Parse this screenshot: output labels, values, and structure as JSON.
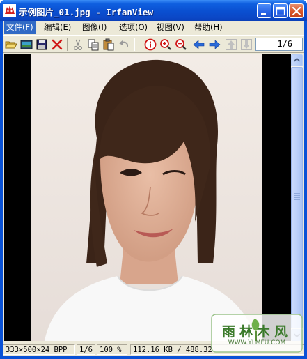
{
  "window": {
    "title": "示例图片_01.jpg - IrfanView",
    "title_icon": "irfanview-red-cat-icon",
    "controls": [
      "minimize-icon",
      "maximize-icon",
      "close-icon"
    ]
  },
  "menu": {
    "items": [
      {
        "label": "文件(F)",
        "active": true
      },
      {
        "label": "编辑(E)",
        "active": false
      },
      {
        "label": "图像(I)",
        "active": false
      },
      {
        "label": "选项(O)",
        "active": false
      },
      {
        "label": "视图(V)",
        "active": false
      },
      {
        "label": "帮助(H)",
        "active": false
      }
    ]
  },
  "toolbar": {
    "icons": [
      "open-folder-icon",
      "slideshow-icon",
      "save-icon",
      "delete-icon",
      "cut-icon",
      "copy-icon",
      "paste-icon",
      "undo-icon",
      "info-icon",
      "zoom-in-icon",
      "zoom-out-icon",
      "previous-arrow-icon",
      "next-arrow-icon",
      "up-arrow-icon",
      "down-arrow-icon"
    ],
    "page_indicator": "1/6"
  },
  "statusbar": {
    "image_info": "333×500×24 BPP",
    "page": "1/6",
    "zoom": "100 %",
    "filesize": "112.16 KB / 488.32"
  },
  "watermark": {
    "text": "雨林木风",
    "url": "WWW.YLMFU.COM"
  },
  "colors": {
    "titlebar": "#0a4fd0",
    "menu_highlight": "#316ac5",
    "chrome": "#ece9d8",
    "view_background": "#000000",
    "watermark_green": "#3a7a2a"
  }
}
